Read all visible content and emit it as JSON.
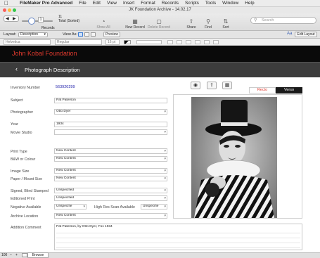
{
  "menubar": {
    "app_name": "FileMaker Pro Advanced",
    "items": [
      "File",
      "Edit",
      "View",
      "Insert",
      "Format",
      "Records",
      "Scripts",
      "Tools",
      "Window",
      "Help"
    ]
  },
  "window": {
    "title": "JK Foundation Archive - 14.02.17"
  },
  "toolbar": {
    "record_number": "1",
    "found_count": "11",
    "total_label": "Total (Sorted)",
    "records_label": "Records",
    "show_all": "Show All",
    "new_record": "New Record",
    "delete_record": "Delete Record",
    "share": "Share",
    "find": "Find",
    "sort": "Sort",
    "search_placeholder": "Search"
  },
  "layoutbar": {
    "layout_label": "Layout:",
    "layout_value": "Description",
    "view_as_label": "View As:",
    "preview": "Preview",
    "edit_layout": "Edit Layout",
    "text_size_icon": "Aa"
  },
  "formatbar": {
    "font": "Helvetica",
    "style": "Regular",
    "size": "16 pt"
  },
  "header": {
    "foundation": "John Kobal Foundation",
    "section": "Photograph Description"
  },
  "fields": {
    "inventory_label": "Inventory Number",
    "inventory_value": "563920299",
    "subject_label": "Subject",
    "subject_value": "Pat Paterson",
    "photographer_label": "Photographer",
    "photographer_value": "Otto Dyer",
    "year_label": "Year",
    "year_value": "1934",
    "studio_label": "Movie Studio",
    "studio_value": "",
    "print_type_label": "Print Type",
    "print_type_value": "New Content",
    "bw_label": "B&W or Colour",
    "bw_value": "New Content",
    "image_size_label": "Image Size",
    "image_size_value": "New Content",
    "paper_label": "Paper / Mount Size",
    "paper_value": "New Content",
    "signed_label": "Signed, Blind Stamped",
    "signed_value": "Unspecified",
    "editioned_label": "Editioned Print",
    "editioned_value": "Unspecified",
    "negative_label": "Negative Available",
    "negative_value": "Unspecifie",
    "highres_label": "High Res Scan Available",
    "highres_value": "Unspecifie",
    "archive_label": "Archive Location",
    "archive_value": "New Content",
    "comment_label": "Addition Comment",
    "comment_value": "Pat Paterson, by Otto Dyer, Fox 1934"
  },
  "tabs": {
    "recto": "Recto",
    "verso": "Verso"
  },
  "status": {
    "zoom": "100",
    "mode": "Browse"
  },
  "colors": {
    "accent_red": "#e03a2e",
    "inventory_blue": "#1a1aa8",
    "header_bg": "#0a0a0a",
    "nav_bg": "#3c3c3c"
  }
}
